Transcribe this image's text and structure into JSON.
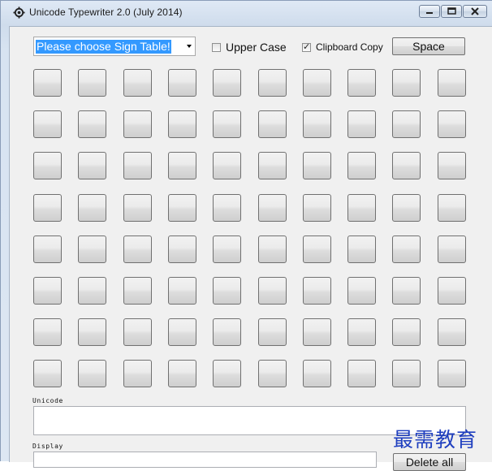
{
  "window": {
    "title": "Unicode Typewriter 2.0 (July 2014)"
  },
  "toolbar": {
    "sign_table": "Please choose Sign Table!",
    "upper_case": {
      "label": "Upper Case",
      "checked": false
    },
    "clipboard_copy": {
      "label": "Clipboard Copy",
      "checked": true
    },
    "space_label": "Space"
  },
  "keys": {
    "rows": 8,
    "cols": 10
  },
  "unicode": {
    "label": "Unicode",
    "value": ""
  },
  "display": {
    "label": "Display",
    "value": ""
  },
  "delete_all_label": "Delete all",
  "watermark": "最需教育",
  "colors": {
    "selection": "#3399ff",
    "watermark": "#1f3fbf"
  }
}
